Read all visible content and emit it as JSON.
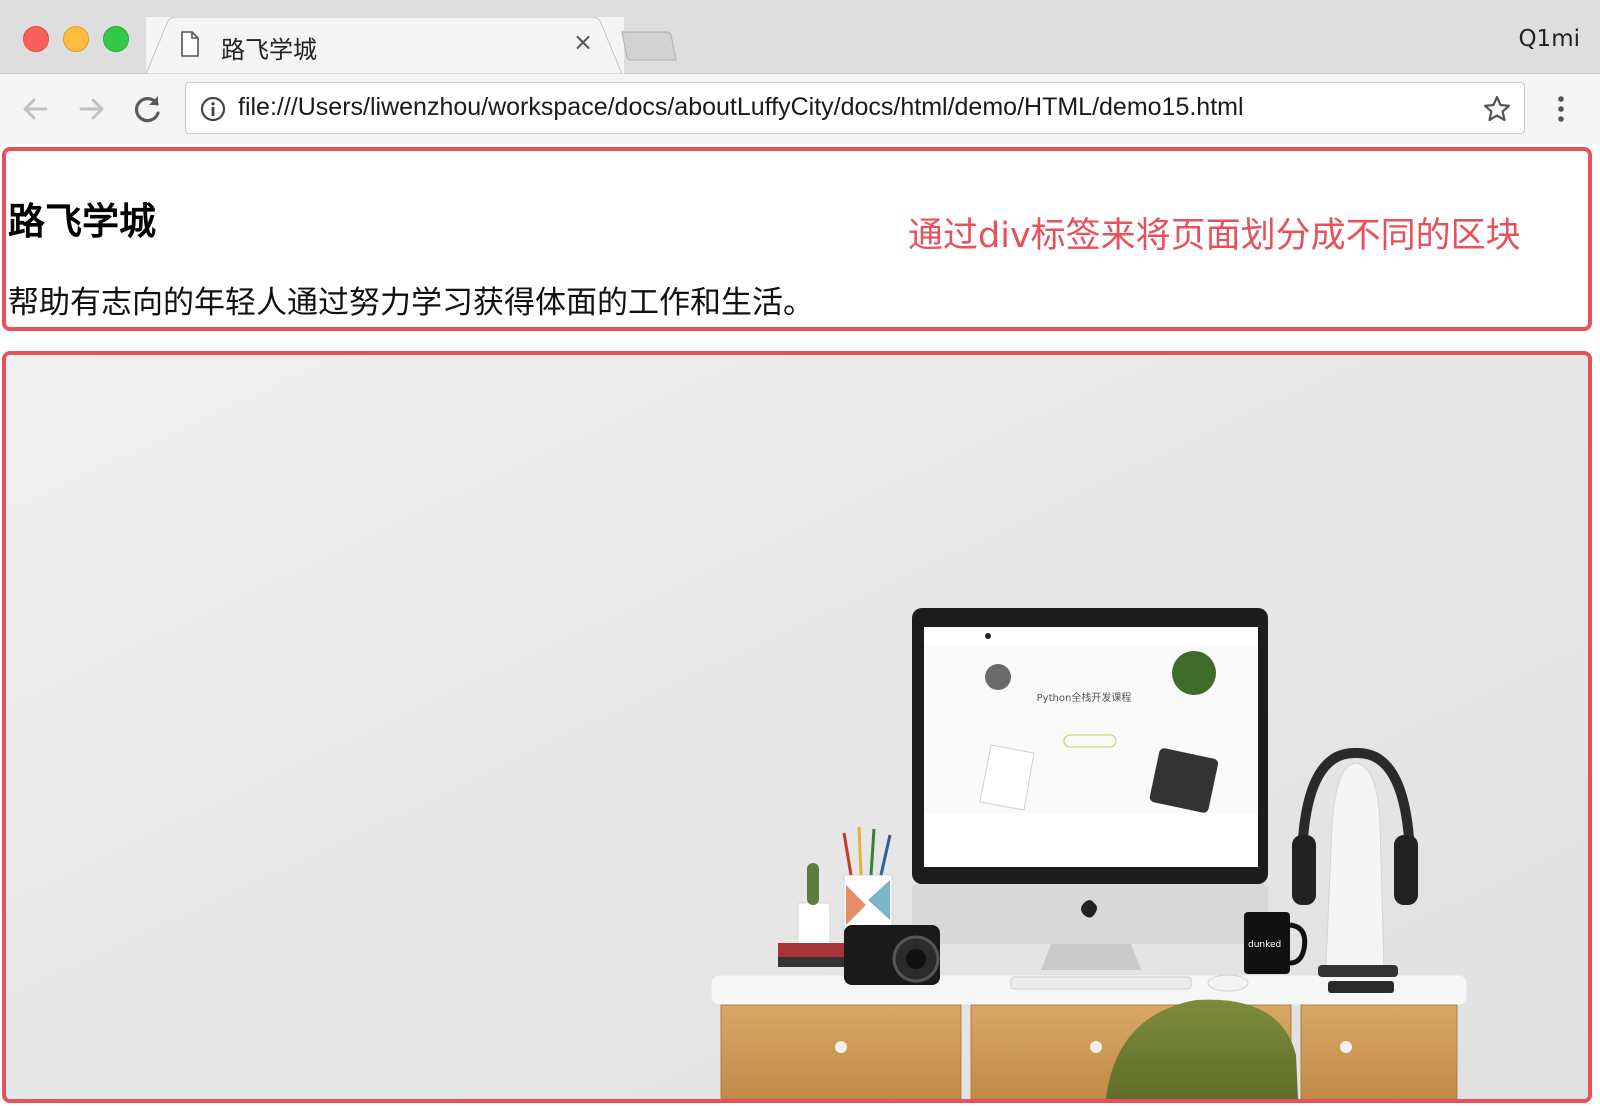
{
  "window": {
    "profile_name": "Q1mi"
  },
  "tab": {
    "title": "路飞学城",
    "close_label": "×"
  },
  "toolbar": {
    "url": "file:///Users/liwenzhou/workspace/docs/aboutLuffyCity/docs/html/demo/HTML/demo15.html"
  },
  "page": {
    "title": "路飞学城",
    "description": "帮助有志向的年轻人通过努力学习获得体面的工作和生活。",
    "annotation": "通过div标签来将页面划分成不同的区块",
    "highlight_color": "#e8505b"
  },
  "image": {
    "screen_title": "Python全栈开发课程",
    "mug_text": "dunked"
  }
}
